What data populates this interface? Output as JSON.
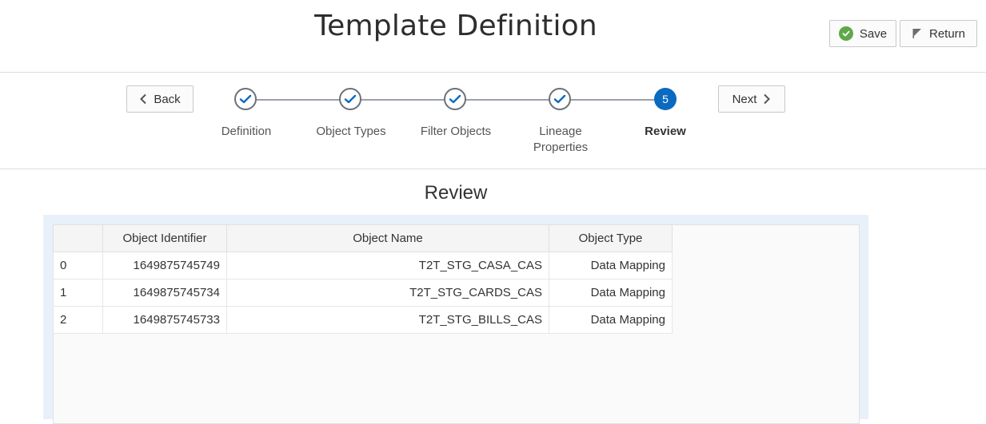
{
  "header": {
    "title": "Template Definition",
    "save_label": "Save",
    "return_label": "Return"
  },
  "train": {
    "back_label": "Back",
    "next_label": "Next",
    "steps": [
      {
        "label": "Definition",
        "state": "complete"
      },
      {
        "label": "Object Types",
        "state": "complete"
      },
      {
        "label": "Filter Objects",
        "state": "complete"
      },
      {
        "label_line1": "Lineage",
        "label_line2": "Properties",
        "state": "complete"
      },
      {
        "label": "Review",
        "number": "5",
        "state": "current"
      }
    ]
  },
  "review": {
    "title": "Review",
    "columns": [
      "",
      "Object Identifier",
      "Object Name",
      "Object Type"
    ],
    "rows": [
      {
        "index": "0",
        "id": "1649875745749",
        "name": "T2T_STG_CASA_CAS",
        "type": "Data Mapping"
      },
      {
        "index": "1",
        "id": "1649875745734",
        "name": "T2T_STG_CARDS_CAS",
        "type": "Data Mapping"
      },
      {
        "index": "2",
        "id": "1649875745733",
        "name": "T2T_STG_BILLS_CAS",
        "type": "Data Mapping"
      }
    ]
  },
  "colors": {
    "accent": "#0a6ac0",
    "success": "#5fa84a",
    "panel_bg": "#e8f1fa"
  },
  "icons": {
    "save": "check-circle-icon",
    "return": "flag-icon",
    "back": "chevron-left-icon",
    "next": "chevron-right-icon",
    "step_done": "checkmark-icon"
  }
}
